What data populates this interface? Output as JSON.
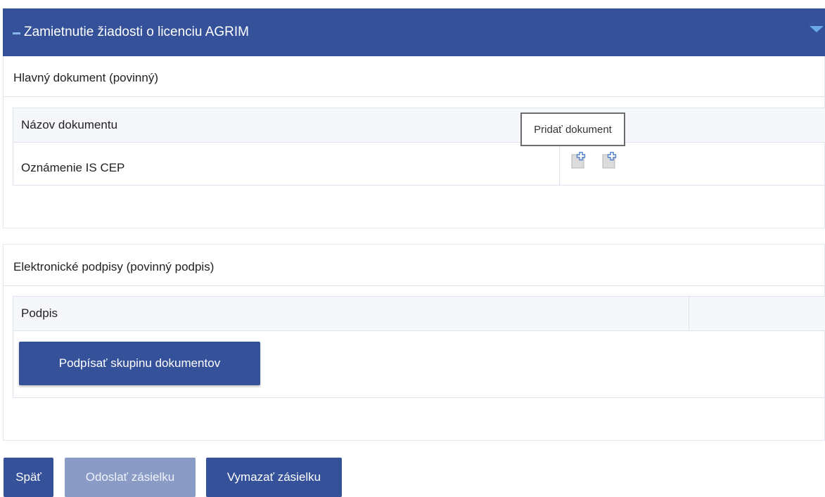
{
  "panel": {
    "title": "Zamietnutie žiadosti o licenciu AGRIM"
  },
  "main_document": {
    "title": "Hlavný dokument (povinný)",
    "column_header": "Názov dokumentu",
    "rows": [
      {
        "name": "Oznámenie IS CEP"
      }
    ],
    "tooltip": "Pridať dokument"
  },
  "signatures": {
    "title": "Elektronické podpisy (povinný podpis)",
    "column_header": "Podpis",
    "sign_button": "Podpísať skupinu dokumentov"
  },
  "actions": {
    "back": "Späť",
    "send": "Odoslať zásielku",
    "delete": "Vymazať zásielku"
  },
  "icons": {
    "collapse": "minus-icon",
    "chevron": "chevron-down-icon",
    "add_document": "add-document-icon"
  },
  "colors": {
    "primary": "#34519a",
    "disabled": "#8a9cc6",
    "accent": "#6aa8e6"
  }
}
